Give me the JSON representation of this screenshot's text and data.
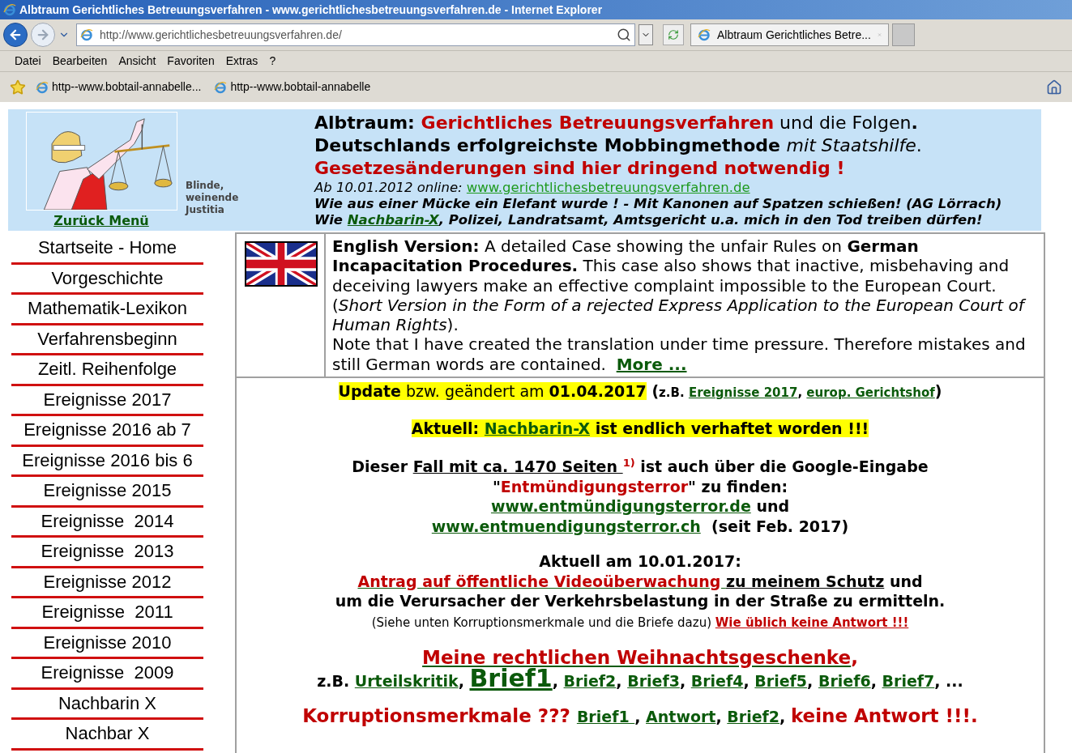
{
  "window": {
    "title": "Albtraum Gerichtliches Betreuungsverfahren - www.gerichtlichesbetreuungsverfahren.de - Internet Explorer"
  },
  "address_bar": {
    "value": "http://www.gerichtlichesbetreuungsverfahren.de/"
  },
  "tabs": [
    {
      "label": "Albtraum Gerichtliches Betre...",
      "selected": true
    }
  ],
  "menu": [
    "Datei",
    "Bearbeiten",
    "Ansicht",
    "Favoriten",
    "Extras",
    "?"
  ],
  "favorites": [
    "http--www.bobtail-annabelle...",
    "http--www.bobtail-annabelle"
  ],
  "header": {
    "caption_lines": [
      "Blinde,",
      "weinende",
      "Justitia"
    ],
    "back_link": "Zurück Menü",
    "lines": [
      {
        "kind": "title",
        "segments": [
          {
            "kind": "b",
            "text": "Albtraum: "
          },
          {
            "kind": "red",
            "text": "Gerichtliches Betreuungsverfahren"
          },
          {
            "kind": "n",
            "text": " und die Folgen"
          },
          {
            "kind": "b",
            "text": "."
          }
        ]
      },
      {
        "kind": "title",
        "segments": [
          {
            "kind": "b",
            "text": "Deutschlands erfolgreichste Mobbingmethode "
          },
          {
            "kind": "i",
            "text": "mit Staatshilfe"
          },
          {
            "kind": "n",
            "text": "."
          }
        ]
      },
      {
        "kind": "title",
        "segments": [
          {
            "kind": "red",
            "text": "Gesetzesänderungen sind hier dringend notwendig !"
          }
        ]
      },
      {
        "kind": "note",
        "segments": [
          {
            "kind": "i",
            "text": "Ab 10.01.2012 online: "
          },
          {
            "kind": "link",
            "text": "www.gerichtlichesbetreuungsverfahren.de"
          }
        ]
      },
      {
        "kind": "note",
        "segments": [
          {
            "kind": "bi",
            "text": "Wie aus einer Mücke ein Elefant wurde ! - Mit Kanonen auf Spatzen schießen! (AG Lörrach)"
          }
        ]
      },
      {
        "kind": "note",
        "segments": [
          {
            "kind": "bi",
            "text": "Wie "
          },
          {
            "kind": "bilink",
            "text": "Nachbarin-X"
          },
          {
            "kind": "bi",
            "text": ", Polizei, Landratsamt, Amtsgericht u.a. mich in den Tod treiben dürfen!"
          }
        ]
      }
    ]
  },
  "nav": [
    "Startseite - Home",
    "Vorgeschichte",
    "Mathematik-Lexikon",
    "Verfahrensbeginn",
    "Zeitl. Reihenfolge",
    "Ereignisse 2017",
    "Ereignisse 2016 ab 7",
    "Ereignisse 2016 bis 6",
    "Ereignisse 2015",
    "Ereignisse  2014",
    "Ereignisse  2013",
    "Ereignisse 2012",
    "Ereignisse  2011",
    "Ereignisse 2010",
    "Ereignisse  2009",
    "Nachbarin X",
    "Nachbar X"
  ],
  "english": {
    "paragraphs": [
      [
        {
          "kind": "b",
          "text": "English Version:"
        },
        {
          "kind": "n",
          "text": " A detailed Case showing the unfair Rules on "
        },
        {
          "kind": "b",
          "text": "German Incapacitation Procedures."
        },
        {
          "kind": "n",
          "text": " This case also shows that inactive, misbehaving and deceiving lawyers make an effective complaint impossible to the European Court. ("
        },
        {
          "kind": "i",
          "text": "Short Version in the Form of a rejected Express Application to the European Court of Human Rights"
        },
        {
          "kind": "n",
          "text": ")."
        }
      ],
      [
        {
          "kind": "n",
          "text": "Note that I have created the translation under time pressure. Therefore mistakes and still German words are contained.  "
        },
        {
          "kind": "blink",
          "text": "More ..."
        }
      ]
    ]
  },
  "main": [
    {
      "lines": [
        [
          {
            "kind": "hb",
            "text": "Update"
          },
          {
            "kind": "hn",
            "text": " bzw. geändert am "
          },
          {
            "kind": "hb",
            "text": "01.04.2017"
          },
          {
            "kind": "b",
            "text": " ("
          },
          {
            "kind": "sb",
            "text": "z.B. "
          },
          {
            "kind": "slink",
            "text": "Ereignisse 2017"
          },
          {
            "kind": "sb",
            "text": ", "
          },
          {
            "kind": "slink",
            "text": "europ. Gerichtshof"
          },
          {
            "kind": "b",
            "text": ")"
          }
        ]
      ]
    },
    {
      "lines": [
        [
          {
            "kind": "hb",
            "text": "Aktuell: "
          },
          {
            "kind": "hlink",
            "text": "Nachbarin-X"
          },
          {
            "kind": "hb",
            "text": " ist endlich verhaftet worden !!!"
          }
        ]
      ]
    },
    {
      "lines": [
        [
          {
            "kind": "b",
            "text": "Dieser "
          },
          {
            "kind": "blacklink",
            "text": "Fall mit ca. 1470 Seiten "
          },
          {
            "kind": "sup",
            "text": "1)"
          },
          {
            "kind": "b",
            "text": " ist auch über die Google-Eingabe"
          }
        ],
        [
          {
            "kind": "b",
            "text": "\""
          },
          {
            "kind": "red",
            "text": "Entmündigungsterror"
          },
          {
            "kind": "b",
            "text": "\" zu finden:"
          }
        ],
        [
          {
            "kind": "blink",
            "text": "www.entmündigungsterror.de"
          },
          {
            "kind": "b",
            "text": " und"
          }
        ],
        [
          {
            "kind": "blink",
            "text": "www.entmuendigungsterror.ch"
          },
          {
            "kind": "b",
            "text": "  (seit Feb. 2017)"
          }
        ]
      ]
    },
    {
      "lines": [
        [
          {
            "kind": "b",
            "text": "Aktuell am 10.01.2017:"
          }
        ],
        [
          {
            "kind": "redlink",
            "text": "Antrag auf öffentliche Videoüberwachung "
          },
          {
            "kind": "blacklink",
            "text": "zu meinem Schutz"
          },
          {
            "kind": "b",
            "text": " und"
          }
        ],
        [
          {
            "kind": "b",
            "text": "um die Verursacher der Verkehrsbelastung in der Straße zu ermitteln."
          }
        ],
        [
          {
            "kind": "small",
            "text": "(Siehe unten Korruptionsmerkmale und die Briefe dazu) "
          },
          {
            "kind": "sredlink",
            "text": "Wie üblich keine Antwort !!!"
          }
        ]
      ]
    },
    {
      "lines": [
        [
          {
            "kind": "bigredlink",
            "text": "Meine rechtlichen Weihnachtsgeschenke"
          },
          {
            "kind": "bigred",
            "text": ","
          }
        ],
        [
          {
            "kind": "b",
            "text": "z.B. "
          },
          {
            "kind": "blink",
            "text": "Urteilskritik"
          },
          {
            "kind": "b",
            "text": ", "
          },
          {
            "kind": "hugelink",
            "text": "Brief1"
          },
          {
            "kind": "b",
            "text": ", "
          },
          {
            "kind": "blink",
            "text": "Brief2"
          },
          {
            "kind": "b",
            "text": ", "
          },
          {
            "kind": "blink",
            "text": "Brief3"
          },
          {
            "kind": "b",
            "text": ", "
          },
          {
            "kind": "blink",
            "text": "Brief4"
          },
          {
            "kind": "b",
            "text": ", "
          },
          {
            "kind": "blink",
            "text": "Brief5"
          },
          {
            "kind": "b",
            "text": ", "
          },
          {
            "kind": "blink",
            "text": "Brief6"
          },
          {
            "kind": "b",
            "text": ", "
          },
          {
            "kind": "blink",
            "text": "Brief7"
          },
          {
            "kind": "b",
            "text": ", ..."
          }
        ]
      ]
    },
    {
      "lines": [
        [
          {
            "kind": "bigred",
            "text": "Korruptionsmerkmale ??? "
          },
          {
            "kind": "blink",
            "text": "Brief1 "
          },
          {
            "kind": "b",
            "text": ", "
          },
          {
            "kind": "blink",
            "text": "Antwort"
          },
          {
            "kind": "b",
            "text": ", "
          },
          {
            "kind": "blink",
            "text": "Brief2"
          },
          {
            "kind": "b",
            "text": ", "
          },
          {
            "kind": "bigred",
            "text": "keine Antwort !!!."
          }
        ]
      ]
    }
  ]
}
